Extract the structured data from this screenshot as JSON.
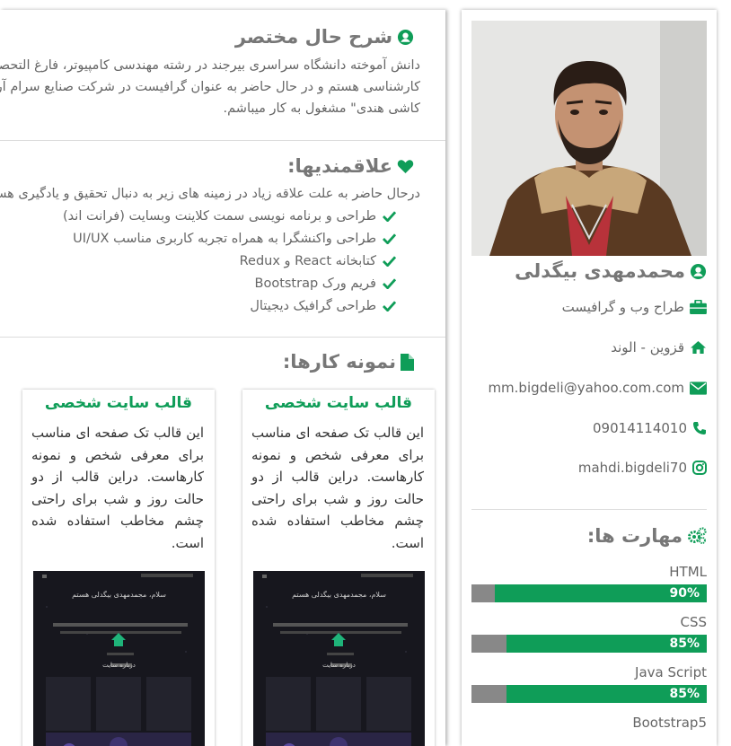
{
  "profile": {
    "name": "محمدمهدی بیگدلی",
    "title": "طراح وب و گرافیست",
    "location": "قزوین - الوند",
    "email": "mm.bigdeli@yahoo.com.com",
    "phone": "09014114010",
    "instagram": "mahdi.bigdeli70"
  },
  "skills": {
    "title": "مهارت ها:",
    "items": [
      {
        "name": "HTML",
        "percent": 90,
        "label": "90%"
      },
      {
        "name": "CSS",
        "percent": 85,
        "label": "85%"
      },
      {
        "name": "Java Script",
        "percent": 85,
        "label": "85%"
      },
      {
        "name": "Bootstrap5"
      }
    ]
  },
  "summary": {
    "title": "شرح حال مختصر",
    "text": "دانش آموخته دانشگاه سراسری بیرجند در رشته مهندسی کامپیوتر، فارغ التحصیل مقطع کارشناسی هستم و در حال حاضر به عنوان گرافیست در شرکت صنایع سرام آرا \"تولید کننده کاشی هندی\" مشغول به کار میباشم."
  },
  "interests": {
    "title": "علاقمندیها:",
    "intro": "درحال حاضر به علت علاقه زیاد در زمینه های زیر به دنبال تحقیق و یادگیری هستم.",
    "items": [
      "طراحی و برنامه نویسی سمت کلاینت وبسایت (فرانت اند)",
      "طراحی واکنشگرا به همراه تجربه کاربری مناسب UI/UX",
      "کتابخانه React و Redux",
      "فریم ورک Bootstrap",
      "طراحی گرافیک دیجیتال"
    ]
  },
  "portfolio": {
    "title": "نمونه کارها:",
    "cards": [
      {
        "title": "قالب سایت شخصی",
        "desc": "این قالب تک صفحه ای مناسب برای معرفی شخص و نمونه کارهاست. دراین قالب از دو حالت روز و شب برای راحتی چشم مخاطب استفاده شده است.",
        "shot_heading": "سلام، محمدمهدی بیگدلی هستم",
        "shot_about": "درباره سایت"
      },
      {
        "title": "قالب سایت شخصی",
        "desc": "این قالب تک صفحه ای مناسب برای معرفی شخص و نمونه کارهاست. دراین قالب از دو حالت روز و شب برای راحتی چشم مخاطب استفاده شده است.",
        "shot_heading": "سلام، محمدمهدی بیگدلی هستم",
        "shot_about": "درباره سایت"
      }
    ]
  },
  "colors": {
    "accent": "#0f9d58",
    "bar_bg": "#888888",
    "text": "#666666"
  }
}
